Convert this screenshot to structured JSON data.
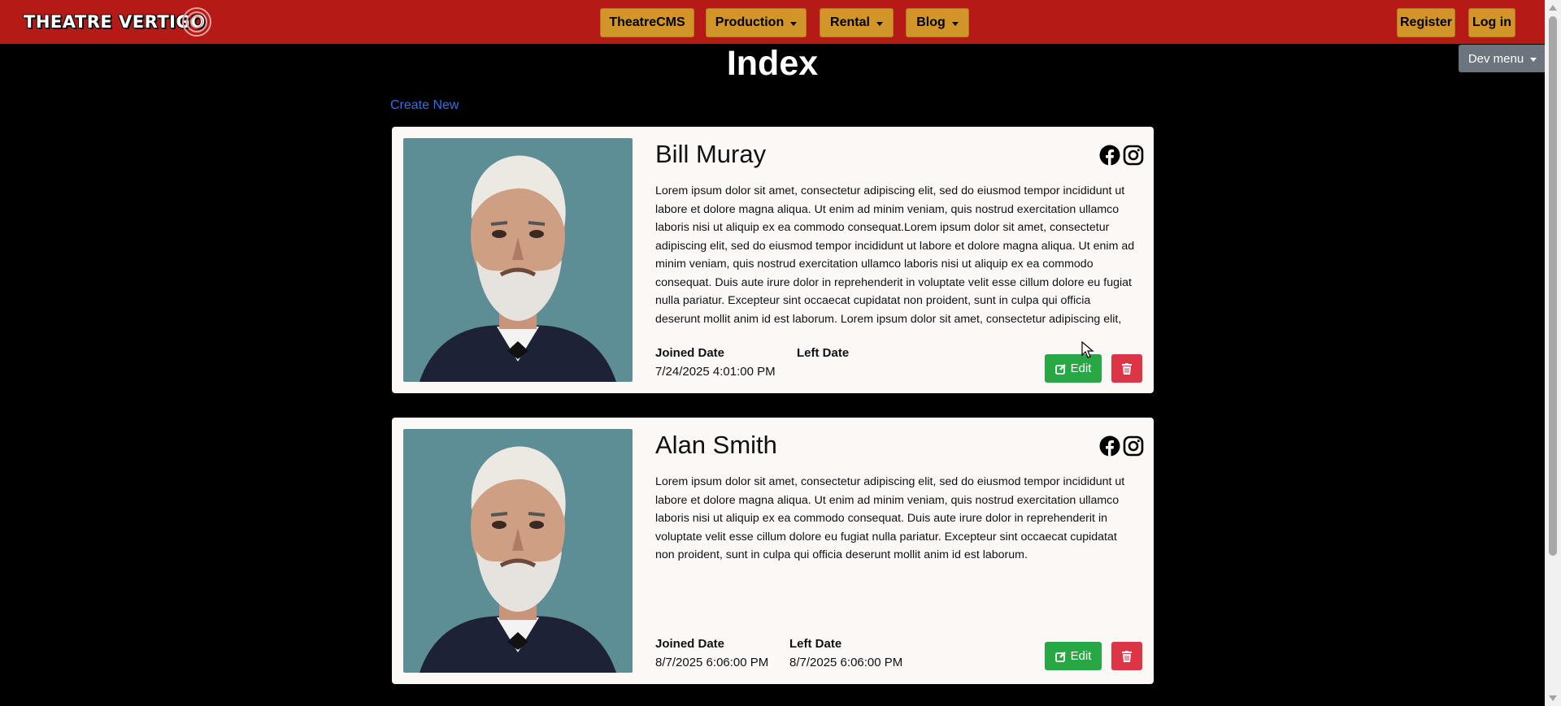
{
  "navbar": {
    "logo_text": "THEATRE VERTIGO",
    "menu": [
      {
        "label": "TheatreCMS",
        "dropdown": false
      },
      {
        "label": "Production",
        "dropdown": true
      },
      {
        "label": "Rental",
        "dropdown": true
      },
      {
        "label": "Blog",
        "dropdown": true
      }
    ],
    "register_label": "Register",
    "login_label": "Log in"
  },
  "dev_menu_label": "Dev menu",
  "page": {
    "title": "Index",
    "create_new_label": "Create New"
  },
  "members": [
    {
      "name": "Bill Muray",
      "bio": "Lorem ipsum dolor sit amet, consectetur adipiscing elit, sed do eiusmod tempor incididunt ut labore et dolore magna aliqua. Ut enim ad minim veniam, quis nostrud exercitation ullamco laboris nisi ut aliquip ex ea commodo consequat.Lorem ipsum dolor sit amet, consectetur adipiscing elit, sed do eiusmod tempor incididunt ut labore et dolore magna aliqua. Ut enim ad minim veniam, quis nostrud exercitation ullamco laboris nisi ut aliquip ex ea commodo consequat. Duis aute irure dolor in reprehenderit in voluptate velit esse cillum dolore eu fugiat nulla pariatur. Excepteur sint occaecat cupidatat non proident, sunt in culpa qui officia deserunt mollit anim id est laborum. Lorem ipsum dolor sit amet, consectetur adipiscing elit, sed do eiusmod tempor.",
      "joined_label": "Joined Date",
      "joined_value": "7/24/2025 4:01:00 PM",
      "left_label": "Left Date",
      "left_value": "",
      "edit_label": "Edit"
    },
    {
      "name": "Alan Smith",
      "bio": "Lorem ipsum dolor sit amet, consectetur adipiscing elit, sed do eiusmod tempor incididunt ut labore et dolore magna aliqua. Ut enim ad minim veniam, quis nostrud exercitation ullamco laboris nisi ut aliquip ex ea commodo consequat. Duis aute irure dolor in reprehenderit in voluptate velit esse cillum dolore eu fugiat nulla pariatur. Excepteur sint occaecat cupidatat non proident, sunt in culpa qui officia deserunt mollit anim id est laborum.",
      "joined_label": "Joined Date",
      "joined_value": "8/7/2025 6:06:00 PM",
      "left_label": "Left Date",
      "left_value": "8/7/2025 6:06:00 PM",
      "edit_label": "Edit"
    }
  ],
  "colors": {
    "navbar": "#b51a16",
    "nav_button": "#d1952a",
    "edit": "#28a745",
    "delete": "#dc3545",
    "link": "#2f6ef0"
  }
}
